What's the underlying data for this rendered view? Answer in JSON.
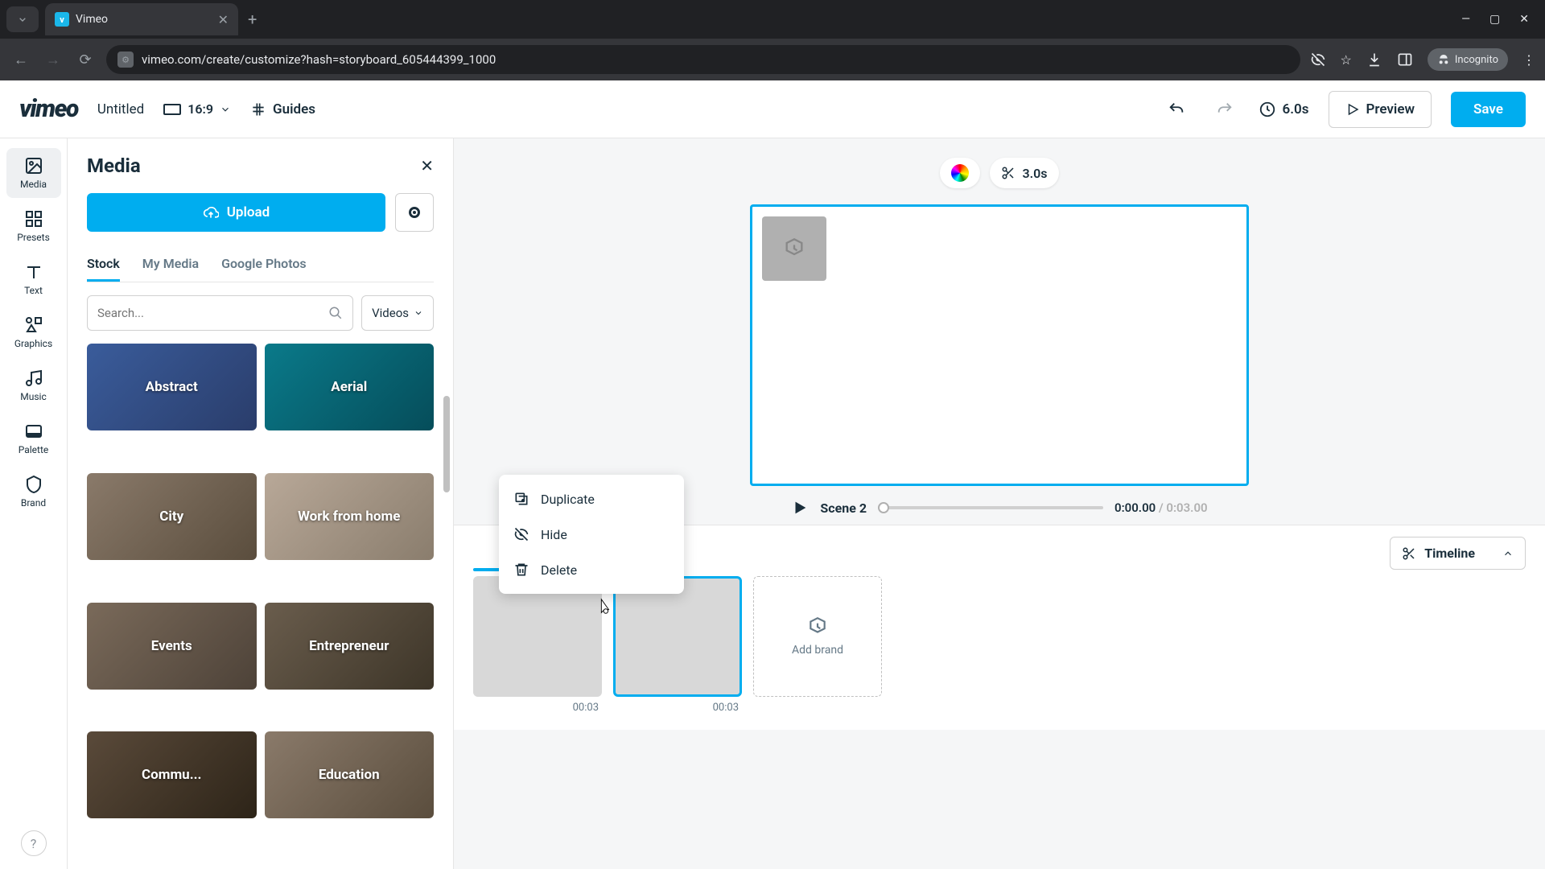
{
  "browser": {
    "tab_title": "Vimeo",
    "url": "vimeo.com/create/customize?hash=storyboard_605444399_1000",
    "incognito_label": "Incognito"
  },
  "header": {
    "logo": "vimeo",
    "project_title": "Untitled",
    "aspect_ratio": "16:9",
    "guides": "Guides",
    "duration": "6.0s",
    "preview": "Preview",
    "save": "Save"
  },
  "rail": {
    "media": "Media",
    "presets": "Presets",
    "text": "Text",
    "graphics": "Graphics",
    "music": "Music",
    "palette": "Palette",
    "brand": "Brand"
  },
  "panel": {
    "title": "Media",
    "upload": "Upload",
    "tabs": {
      "stock": "Stock",
      "my_media": "My Media",
      "google_photos": "Google Photos"
    },
    "search_placeholder": "Search...",
    "filter": "Videos",
    "cards": {
      "abstract": "Abstract",
      "aerial": "Aerial",
      "city": "City",
      "wfh": "Work from home",
      "events": "Events",
      "entrepreneur": "Entrepreneur",
      "community": "Commu...",
      "education": "Education"
    }
  },
  "canvas": {
    "trim_time": "3.0s",
    "scene_label": "Scene 2",
    "time_current": "0:00.00",
    "time_total": " / 0:03.00"
  },
  "timeline": {
    "toggle": "Timeline",
    "scene1_time": "00:03",
    "scene2_time": "00:03",
    "add_brand": "Add brand"
  },
  "context_menu": {
    "duplicate": "Duplicate",
    "hide": "Hide",
    "delete": "Delete"
  }
}
